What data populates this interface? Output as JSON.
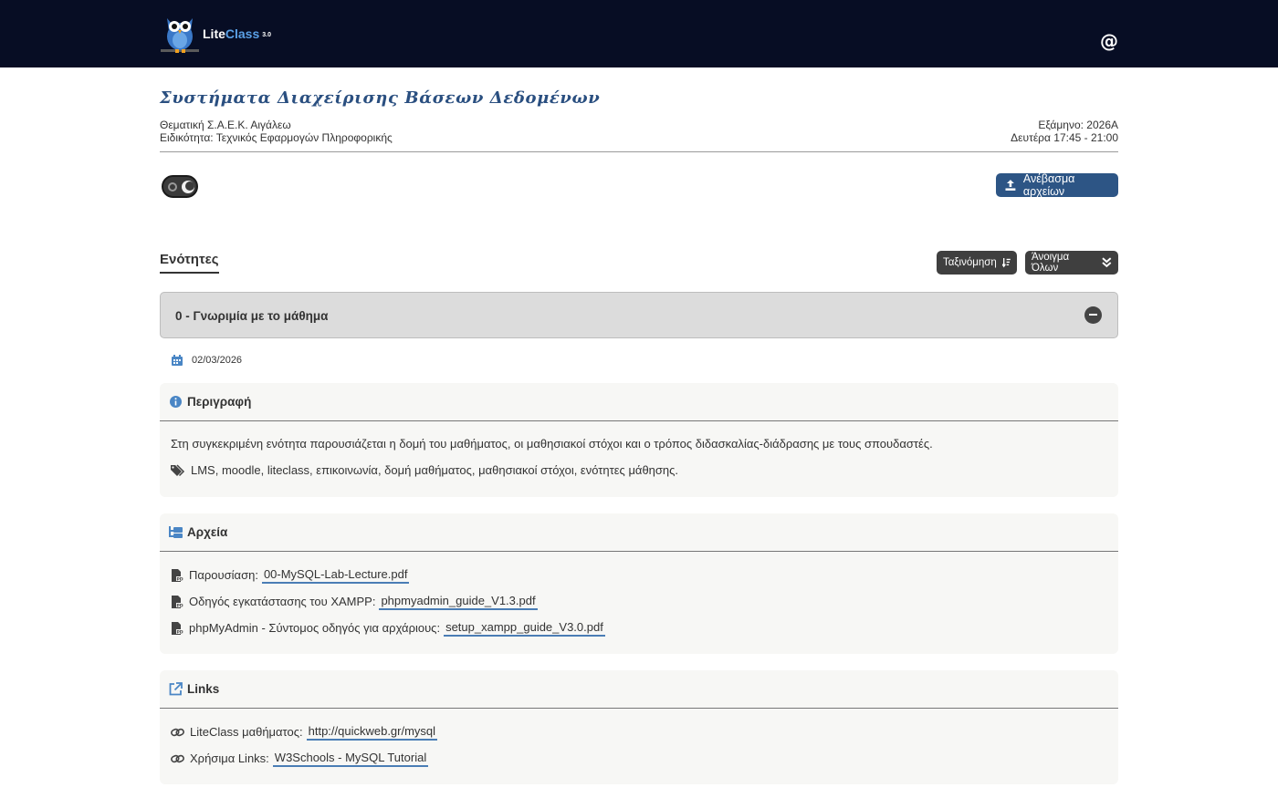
{
  "header": {
    "brand_lite": "Lite",
    "brand_class": "Class",
    "brand_version": "3.0"
  },
  "course": {
    "title": "Συστήματα Διαχείρισης Βάσεων Δεδομένων",
    "thematic": "Θεματική Σ.Α.Ε.Κ. Αιγάλεω",
    "specialty": "Ειδικότητα: Τεχνικός Εφαρμογών Πληροφορικής",
    "semester": "Εξάμηνο: 2026Α",
    "schedule": "Δευτέρα 17:45 - 21:00"
  },
  "toolbar": {
    "upload_label": "Ανέβασμα αρχείων"
  },
  "sections": {
    "title": "Ενότητες",
    "sort_label": "Ταξινόμηση",
    "open_all_label": "Άνοιγμα Όλων",
    "current": {
      "label": "0 - Γνωριμία με το μάθημα",
      "date": "02/03/2026"
    }
  },
  "description": {
    "title": "Περιγραφή",
    "text": "Στη συγκεκριμένη ενότητα παρουσιάζεται η δομή του μαθήματος, οι μαθησιακοί στόχοι και ο τρόπος διδασκαλίας-διάδρασης με τους σπουδαστές.",
    "tags": "LMS, moodle, liteclass, επικοινωνία, δομή μαθήματος, μαθησιακοί στόχοι, ενότητες μάθησης."
  },
  "files": {
    "title": "Αρχεία",
    "items": [
      {
        "label": "Παρουσίαση:",
        "file": "00-MySQL-Lab-Lecture.pdf"
      },
      {
        "label": "Οδηγός εγκατάστασης του XAMPP:",
        "file": "phpmyadmin_guide_V1.3.pdf"
      },
      {
        "label": "phpMyAdmin - Σύντομος οδηγός για αρχάριους:",
        "file": "setup_xampp_guide_V3.0.pdf"
      }
    ]
  },
  "links": {
    "title": "Links",
    "items": [
      {
        "label": "LiteClass μαθήματος:",
        "link": "http://quickweb.gr/mysql"
      },
      {
        "label": "Χρήσιμα Links:",
        "link": "W3Schools - MySQL Tutorial"
      }
    ]
  },
  "colors": {
    "topbar": "#070d24",
    "accent": "#2d5585",
    "title": "#2a4f80",
    "link_underline": "#4a7db5"
  }
}
